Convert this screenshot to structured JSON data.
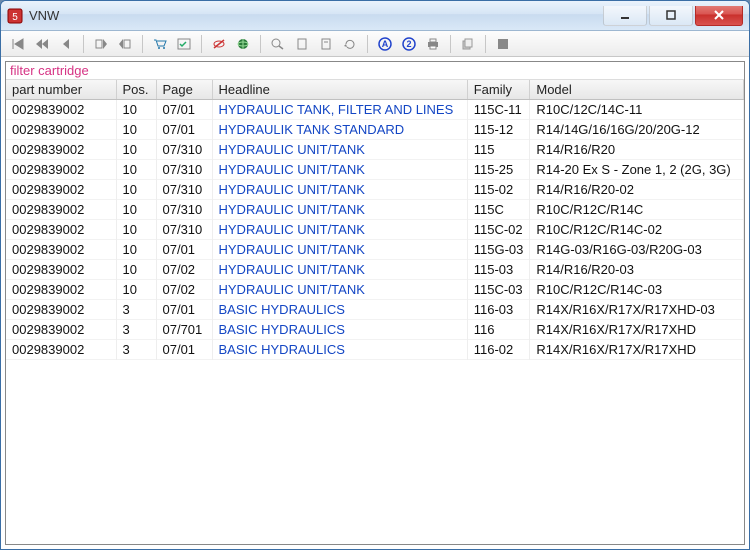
{
  "window": {
    "title": "VNW"
  },
  "filter": {
    "label": "filter cartridge"
  },
  "columns": {
    "part": "part number",
    "pos": "Pos.",
    "page": "Page",
    "headline": "Headline",
    "family": "Family",
    "model": "Model"
  },
  "rows": [
    {
      "part": "0029839002",
      "pos": "10",
      "page": "07/01",
      "headline": "HYDRAULIC TANK, FILTER AND LINES",
      "family": "115C-11",
      "model": "R10C/12C/14C-11"
    },
    {
      "part": "0029839002",
      "pos": "10",
      "page": "07/01",
      "headline": "HYDRAULIK TANK STANDARD",
      "family": "115-12",
      "model": "R14/14G/16/16G/20/20G-12"
    },
    {
      "part": "0029839002",
      "pos": "10",
      "page": "07/310",
      "headline": "HYDRAULIC UNIT/TANK",
      "family": "115",
      "model": "R14/R16/R20"
    },
    {
      "part": "0029839002",
      "pos": "10",
      "page": "07/310",
      "headline": "HYDRAULIC UNIT/TANK",
      "family": "115-25",
      "model": "R14-20 Ex S - Zone 1, 2 (2G, 3G)"
    },
    {
      "part": "0029839002",
      "pos": "10",
      "page": "07/310",
      "headline": "HYDRAULIC UNIT/TANK",
      "family": "115-02",
      "model": "R14/R16/R20-02"
    },
    {
      "part": "0029839002",
      "pos": "10",
      "page": "07/310",
      "headline": "HYDRAULIC UNIT/TANK",
      "family": "115C",
      "model": "R10C/R12C/R14C"
    },
    {
      "part": "0029839002",
      "pos": "10",
      "page": "07/310",
      "headline": "HYDRAULIC UNIT/TANK",
      "family": "115C-02",
      "model": "R10C/R12C/R14C-02"
    },
    {
      "part": "0029839002",
      "pos": "10",
      "page": "07/01",
      "headline": "HYDRAULIC UNIT/TANK",
      "family": "115G-03",
      "model": "R14G-03/R16G-03/R20G-03"
    },
    {
      "part": "0029839002",
      "pos": "10",
      "page": "07/02",
      "headline": "HYDRAULIC UNIT/TANK",
      "family": "115-03",
      "model": "R14/R16/R20-03"
    },
    {
      "part": "0029839002",
      "pos": "10",
      "page": "07/02",
      "headline": "HYDRAULIC UNIT/TANK",
      "family": "115C-03",
      "model": "R10C/R12C/R14C-03"
    },
    {
      "part": "0029839002",
      "pos": "3",
      "page": "07/01",
      "headline": "BASIC HYDRAULICS",
      "family": "116-03",
      "model": "R14X/R16X/R17X/R17XHD-03"
    },
    {
      "part": "0029839002",
      "pos": "3",
      "page": "07/701",
      "headline": "BASIC HYDRAULICS",
      "family": "116",
      "model": "R14X/R16X/R17X/R17XHD"
    },
    {
      "part": "0029839002",
      "pos": "3",
      "page": "07/01",
      "headline": "BASIC HYDRAULICS",
      "family": "116-02",
      "model": "R14X/R16X/R17X/R17XHD"
    }
  ],
  "toolbar_icons": [
    "nav-first-icon",
    "nav-fastback-icon",
    "nav-back-icon",
    "mark-icon",
    "unmark-icon",
    "cart-icon",
    "checked-list-icon",
    "no-eye-icon",
    "globe-icon",
    "zoom-icon",
    "page-icon",
    "page2-icon",
    "cycle-icon",
    "a-circle-icon",
    "two-circle-icon",
    "print-icon",
    "doc-stack-icon",
    "stop-icon"
  ]
}
